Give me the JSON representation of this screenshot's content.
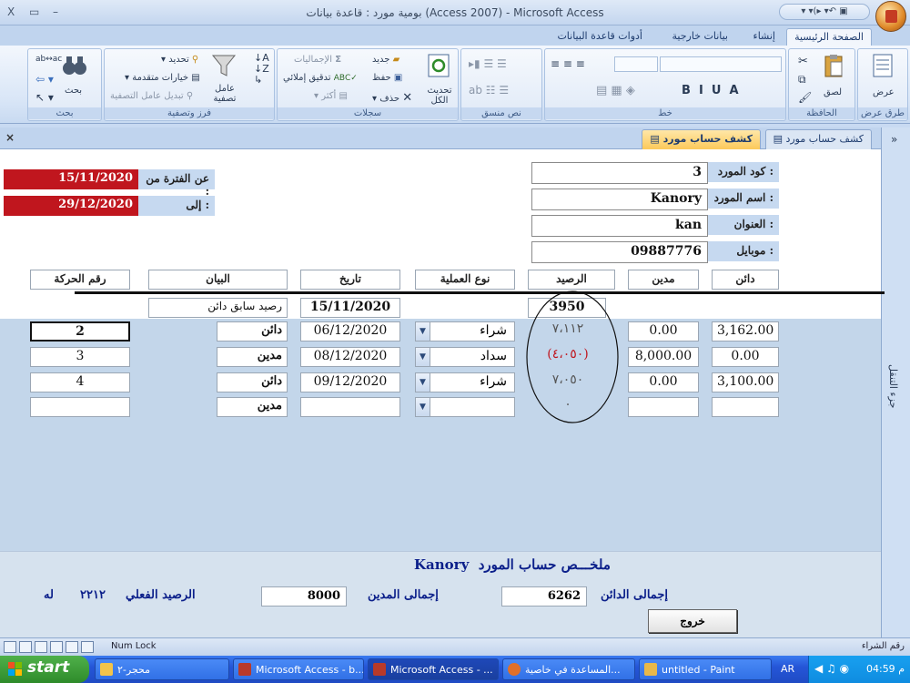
{
  "window": {
    "title": "بومية مورد : قاعدة بيانات (Access 2007) - Microsoft Access",
    "controls": [
      "X",
      "▭",
      "–"
    ],
    "qat_symbols": "▾ ▾(▸ ▾↶ ▣"
  },
  "ribbon_tabs": [
    {
      "label": "الصفحة الرئيسية",
      "active": true
    },
    {
      "label": "إنشاء",
      "active": false
    },
    {
      "label": "بيانات خارجية",
      "active": false
    },
    {
      "label": "أدوات قاعدة البيانات",
      "active": false
    }
  ],
  "ribbon": {
    "views": {
      "label": "عرض",
      "group": "طرق عرض"
    },
    "clipboard": {
      "paste": "لصق",
      "group": "الحافظة"
    },
    "font": {
      "group": "خط"
    },
    "richtext": {
      "group": "نص منسق"
    },
    "records": {
      "refresh": "تحديث الكل",
      "new": "جديد",
      "save": "حفظ",
      "delete": "حذف",
      "totals": "الإجماليات",
      "spelling": "تدقيق إملائي",
      "more": "أكثر",
      "group": "سجلات"
    },
    "sortfilter": {
      "filter": "عامل تصفية",
      "selection": "تحديد",
      "advanced": "خيارات متقدمة",
      "toggle": "تبديل عامل التصفية",
      "group": "فرز وتصفية"
    },
    "find": {
      "find": "بحث",
      "group": "بحث"
    }
  },
  "doc_tabs": [
    {
      "label": "كشف حساب مورد",
      "active": true
    },
    {
      "label": "كشف حساب مورد",
      "active": false
    }
  ],
  "nav_pane": {
    "label": "جزء التنقل",
    "chevron": "»"
  },
  "header": {
    "supplier_code_label": "كود المورد :",
    "supplier_code": "3",
    "supplier_name_label": "اسم المورد :",
    "supplier_name": "Kanory",
    "address_label": "العنوان :",
    "address": "kan",
    "mobile_label": "موبايل :",
    "mobile": "09887776",
    "from_label": "عن الفترة من :",
    "from_date": "15/11/2020",
    "to_label": "إلى :",
    "to_date": "29/12/2020"
  },
  "columns": {
    "credit": "دائن",
    "debit": "مدين",
    "balance": "الرصيد",
    "op_type": "نوع العملية",
    "date": "تاريخ",
    "description": "البيان",
    "txn_no": "رقم الحركة"
  },
  "opening": {
    "balance": "3950",
    "date": "15/11/2020",
    "description": "رصيد سابق  دائن"
  },
  "rows": [
    {
      "credit": "3,162.00",
      "debit": "0.00",
      "balance": "٧،١١٢",
      "negative": false,
      "op": "شراء",
      "date": "06/12/2020",
      "desc": "دائن",
      "no": "2"
    },
    {
      "credit": "0.00",
      "debit": "8,000.00",
      "balance": "(٤،٠٥٠)",
      "negative": true,
      "op": "سداد",
      "date": "08/12/2020",
      "desc": "مدين",
      "no": "3"
    },
    {
      "credit": "3,100.00",
      "debit": "0.00",
      "balance": "٧،٠٥٠",
      "negative": false,
      "op": "شراء",
      "date": "09/12/2020",
      "desc": "دائن",
      "no": "4"
    },
    {
      "credit": "",
      "debit": "",
      "balance": "٠",
      "negative": false,
      "op": "",
      "date": "",
      "desc": "مدين",
      "no": ""
    }
  ],
  "summary": {
    "title_prefix": "ملخـــص  حساب المورد",
    "supplier_name": "Kanory",
    "total_credit_label": "إجمالى الدائن",
    "total_credit": "6262",
    "total_debit_label": "إجمالى المدين",
    "total_debit": "8000",
    "actual_balance_label": "الرصيد الفعلي",
    "actual_balance": "٢٢١٢",
    "actual_balance_suffix": "له",
    "exit_button": "خروج"
  },
  "statusbar": {
    "left_text": "رقم الشراء",
    "numlock": "Num Lock"
  },
  "taskbar": {
    "start": "start",
    "tasks": [
      {
        "label": "محجر-٢",
        "active": false
      },
      {
        "label": "Microsoft Access - b...",
        "active": false
      },
      {
        "label": "Microsoft Access - ...",
        "active": true
      },
      {
        "label": "المساعدة في خاصية...",
        "active": false
      },
      {
        "label": "untitled - Paint",
        "active": false
      }
    ],
    "lang": "AR",
    "clock": "04:59 م"
  },
  "colors": {
    "accent_red": "#c0161e",
    "summary_blue": "#0b1f8a",
    "ribbon_bg": "#d9e6f7",
    "taskbar_blue": "#2556d8",
    "start_green": "#2e8b2a"
  }
}
